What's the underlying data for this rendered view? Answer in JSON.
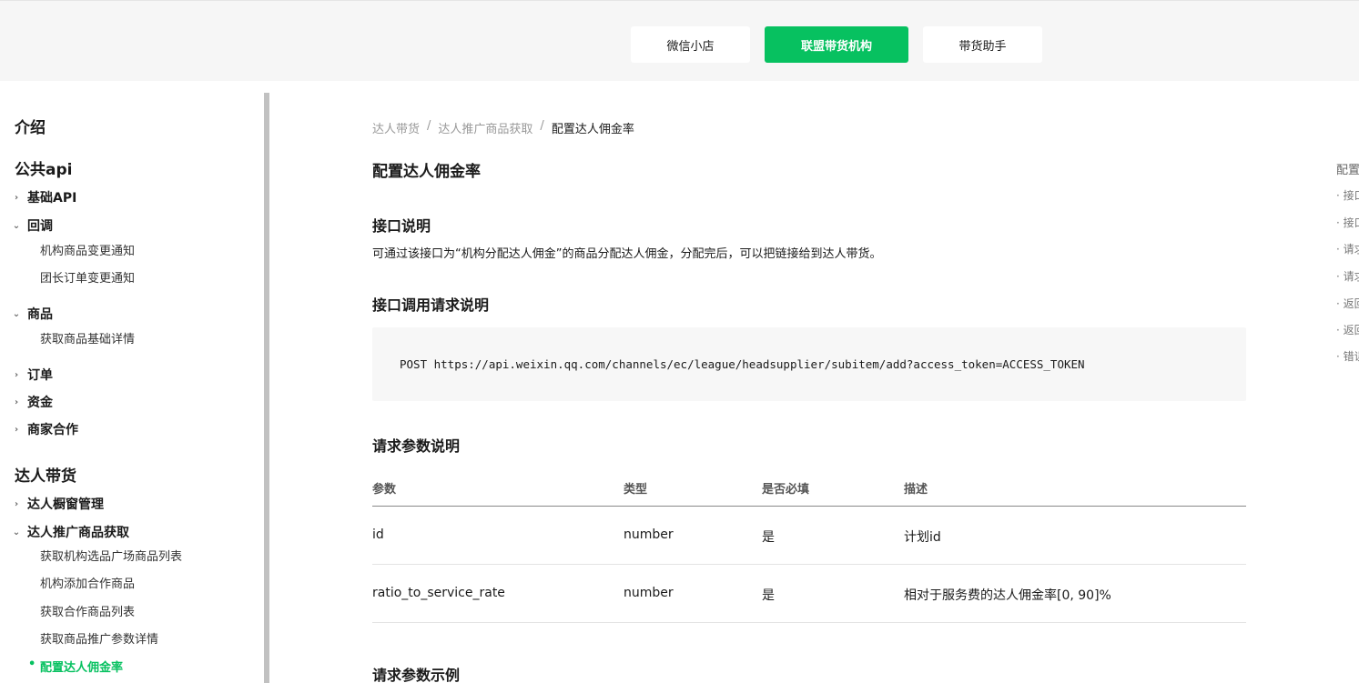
{
  "topbar": {
    "tabs": [
      {
        "label": "微信小店",
        "active": false
      },
      {
        "label": "联盟带货机构",
        "active": true
      },
      {
        "label": "带货助手",
        "active": false
      }
    ]
  },
  "sidebar": {
    "intro": "介绍",
    "public_api": "公共api",
    "basic_api": "基础API",
    "callback": "回调",
    "callback_items": [
      "机构商品变更通知",
      "团长订单变更通知"
    ],
    "goods": "商品",
    "goods_items": [
      "获取商品基础详情"
    ],
    "order": "订单",
    "funds": "资金",
    "merchant_coop": "商家合作",
    "talent_sales": "达人带货",
    "talent_window": "达人橱窗管理",
    "talent_promo": "达人推广商品获取",
    "talent_promo_items": [
      "获取机构选品广场商品列表",
      "机构添加合作商品",
      "获取合作商品列表",
      "获取商品推广参数详情",
      "配置达人佣金率"
    ]
  },
  "breadcrumb": [
    "达人带货",
    "达人推广商品获取",
    "配置达人佣金率"
  ],
  "main": {
    "title": "配置达人佣金率",
    "sec_desc_title": "接口说明",
    "desc": "可通过该接口为“机构分配达人佣金”的商品分配达人佣金，分配完后，可以把链接给到达人带货。",
    "sec_request_title": "接口调用请求说明",
    "code": "POST https://api.weixin.qq.com/channels/ec/league/headsupplier/subitem/add?access_token=ACCESS_TOKEN",
    "sec_params_title": "请求参数说明",
    "table": {
      "headers": [
        "参数",
        "类型",
        "是否必填",
        "描述"
      ],
      "rows": [
        [
          "id",
          "number",
          "是",
          "计划id"
        ],
        [
          "ratio_to_service_rate",
          "number",
          "是",
          "相对于服务费的达人佣金率[0, 90]%"
        ]
      ]
    },
    "sec_example_title": "请求参数示例"
  },
  "toc": {
    "title": "配置",
    "items": [
      "· 接口",
      "· 接口",
      "· 请求",
      "· 请求",
      "· 返回",
      "· 返回",
      "· 错误"
    ]
  }
}
